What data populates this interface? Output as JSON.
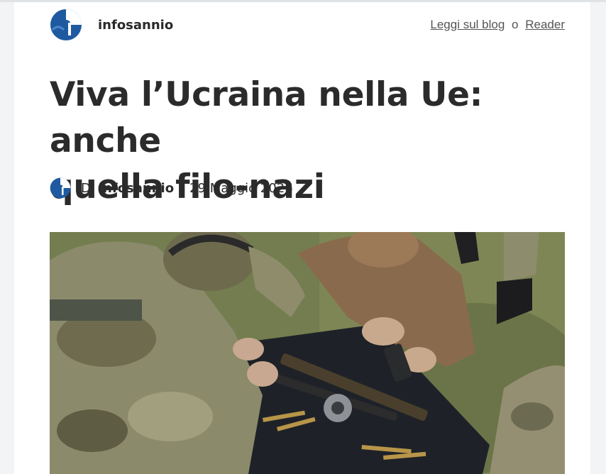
{
  "header": {
    "site_name": "infosannio",
    "read_on_blog": "Leggi sul blog",
    "or": "o",
    "reader": "Reader",
    "logo_icon": "infosannio-logo-icon"
  },
  "article": {
    "title_line1": "Viva l’Ucraina nella Ue: anche",
    "title_line2": "quella filo-nazi",
    "byline_prefix": "Di",
    "byline_author": "infosannio",
    "byline_date_prefix": "il",
    "byline_date": "29 Maggio 2026"
  },
  "colors": {
    "logo_blue": "#1f5aa0",
    "text": "#2a2a2a",
    "link": "#555555"
  }
}
